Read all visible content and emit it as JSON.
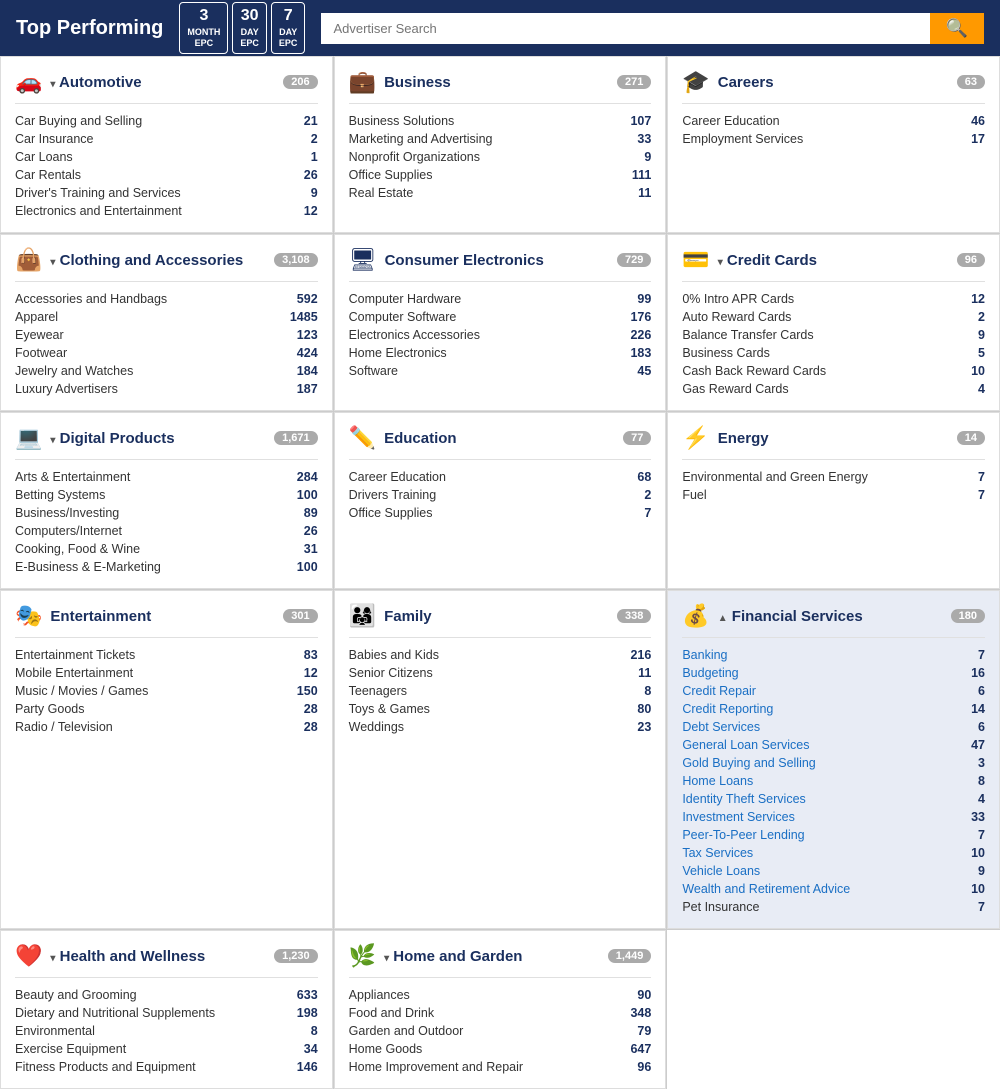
{
  "header": {
    "title": "Top Performing",
    "epc_buttons": [
      {
        "number": "3",
        "label": "MONTH\nEPC"
      },
      {
        "number": "30",
        "label": "DAY\nEPC"
      },
      {
        "number": "7",
        "label": "DAY\nEPC"
      }
    ],
    "search_placeholder": "Advertiser Search"
  },
  "categories": [
    {
      "id": "automotive",
      "name": "Automotive",
      "icon": "🚗",
      "count": 206,
      "expandable": true,
      "items": [
        {
          "label": "Car Buying and Selling",
          "value": 21
        },
        {
          "label": "Car Insurance",
          "value": 2
        },
        {
          "label": "Car Loans",
          "value": 1
        },
        {
          "label": "Car Rentals",
          "value": 26
        },
        {
          "label": "Driver's Training and Services",
          "value": 9
        },
        {
          "label": "Electronics and Entertainment",
          "value": 12
        }
      ]
    },
    {
      "id": "business",
      "name": "Business",
      "icon": "💼",
      "count": 271,
      "expandable": false,
      "items": [
        {
          "label": "Business Solutions",
          "value": 107
        },
        {
          "label": "Marketing and Advertising",
          "value": 33
        },
        {
          "label": "Nonprofit Organizations",
          "value": 9
        },
        {
          "label": "Office Supplies",
          "value": 111
        },
        {
          "label": "Real Estate",
          "value": 11
        }
      ]
    },
    {
      "id": "careers",
      "name": "Careers",
      "icon": "🎓",
      "count": 63,
      "expandable": false,
      "items": [
        {
          "label": "Career Education",
          "value": 46
        },
        {
          "label": "Employment Services",
          "value": 17
        }
      ]
    },
    {
      "id": "clothing",
      "name": "Clothing and Accessories",
      "icon": "👜",
      "count": 3108,
      "expandable": true,
      "items": [
        {
          "label": "Accessories and Handbags",
          "value": 592
        },
        {
          "label": "Apparel",
          "value": 1485
        },
        {
          "label": "Eyewear",
          "value": 123
        },
        {
          "label": "Footwear",
          "value": 424
        },
        {
          "label": "Jewelry and Watches",
          "value": 184
        },
        {
          "label": "Luxury Advertisers",
          "value": 187
        }
      ]
    },
    {
      "id": "consumer-electronics",
      "name": "Consumer Electronics",
      "icon": "🖥",
      "count": 729,
      "expandable": false,
      "items": [
        {
          "label": "Computer Hardware",
          "value": 99
        },
        {
          "label": "Computer Software",
          "value": 176
        },
        {
          "label": "Electronics Accessories",
          "value": 226
        },
        {
          "label": "Home Electronics",
          "value": 183
        },
        {
          "label": "Software",
          "value": 45
        }
      ]
    },
    {
      "id": "credit-cards",
      "name": "Credit Cards",
      "icon": "💳",
      "count": 96,
      "expandable": true,
      "items": [
        {
          "label": "0% Intro APR Cards",
          "value": 12
        },
        {
          "label": "Auto Reward Cards",
          "value": 2
        },
        {
          "label": "Balance Transfer Cards",
          "value": 9
        },
        {
          "label": "Business Cards",
          "value": 5
        },
        {
          "label": "Cash Back Reward Cards",
          "value": 10
        },
        {
          "label": "Gas Reward Cards",
          "value": 4
        }
      ]
    },
    {
      "id": "digital-products",
      "name": "Digital Products",
      "icon": "💻",
      "count": 1671,
      "expandable": true,
      "items": [
        {
          "label": "Arts & Entertainment",
          "value": 284
        },
        {
          "label": "Betting Systems",
          "value": 100
        },
        {
          "label": "Business/Investing",
          "value": 89
        },
        {
          "label": "Computers/Internet",
          "value": 26
        },
        {
          "label": "Cooking, Food & Wine",
          "value": 31
        },
        {
          "label": "E-Business & E-Marketing",
          "value": 100
        }
      ]
    },
    {
      "id": "education",
      "name": "Education",
      "icon": "✏️",
      "count": 77,
      "expandable": false,
      "items": [
        {
          "label": "Career Education",
          "value": 68
        },
        {
          "label": "Drivers Training",
          "value": 2
        },
        {
          "label": "Office Supplies",
          "value": 7
        }
      ]
    },
    {
      "id": "energy",
      "name": "Energy",
      "icon": "⚡",
      "count": 14,
      "expandable": false,
      "items": [
        {
          "label": "Environmental and Green Energy",
          "value": 7
        },
        {
          "label": "Fuel",
          "value": 7
        }
      ]
    },
    {
      "id": "entertainment",
      "name": "Entertainment",
      "icon": "🎭",
      "count": 301,
      "expandable": false,
      "items": [
        {
          "label": "Entertainment Tickets",
          "value": 83
        },
        {
          "label": "Mobile Entertainment",
          "value": 12
        },
        {
          "label": "Music / Movies / Games",
          "value": 150
        },
        {
          "label": "Party Goods",
          "value": 28
        },
        {
          "label": "Radio / Television",
          "value": 28
        }
      ]
    },
    {
      "id": "family",
      "name": "Family",
      "icon": "👨‍👩‍👧",
      "count": 338,
      "expandable": false,
      "items": [
        {
          "label": "Babies and Kids",
          "value": 216
        },
        {
          "label": "Senior Citizens",
          "value": 11
        },
        {
          "label": "Teenagers",
          "value": 8
        },
        {
          "label": "Toys & Games",
          "value": 80
        },
        {
          "label": "Weddings",
          "value": 23
        }
      ]
    },
    {
      "id": "financial-services",
      "name": "Financial Services",
      "icon": "💰",
      "count": 180,
      "expandable": true,
      "highlighted": true,
      "expanded": true,
      "items": [
        {
          "label": "Banking",
          "value": 7
        },
        {
          "label": "Budgeting",
          "value": 16
        },
        {
          "label": "Credit Repair",
          "value": 6
        },
        {
          "label": "Credit Reporting",
          "value": 14
        },
        {
          "label": "Debt Services",
          "value": 6
        },
        {
          "label": "General Loan Services",
          "value": 47
        },
        {
          "label": "Gold Buying and Selling",
          "value": 3
        },
        {
          "label": "Home Loans",
          "value": 8
        },
        {
          "label": "Identity Theft Services",
          "value": 4
        },
        {
          "label": "Investment Services",
          "value": 33
        },
        {
          "label": "Peer-To-Peer Lending",
          "value": 7
        },
        {
          "label": "Tax Services",
          "value": 10
        },
        {
          "label": "Vehicle Loans",
          "value": 9
        },
        {
          "label": "Wealth and Retirement Advice",
          "value": 10
        }
      ],
      "extra": [
        {
          "label": "Pet Insurance",
          "value": 7
        }
      ]
    },
    {
      "id": "health-wellness",
      "name": "Health and Wellness",
      "icon": "❤️",
      "count": 1230,
      "expandable": true,
      "items": [
        {
          "label": "Beauty and Grooming",
          "value": 633
        },
        {
          "label": "Dietary and Nutritional Supplements",
          "value": 198
        },
        {
          "label": "Environmental",
          "value": 8
        },
        {
          "label": "Exercise Equipment",
          "value": 34
        },
        {
          "label": "Fitness Products and Equipment",
          "value": 146
        }
      ]
    },
    {
      "id": "home-garden",
      "name": "Home and Garden",
      "icon": "🌿",
      "count": 1449,
      "expandable": true,
      "items": [
        {
          "label": "Appliances",
          "value": 90
        },
        {
          "label": "Food and Drink",
          "value": 348
        },
        {
          "label": "Garden and Outdoor",
          "value": 79
        },
        {
          "label": "Home Goods",
          "value": 647
        },
        {
          "label": "Home Improvement and Repair",
          "value": 96
        }
      ]
    }
  ]
}
